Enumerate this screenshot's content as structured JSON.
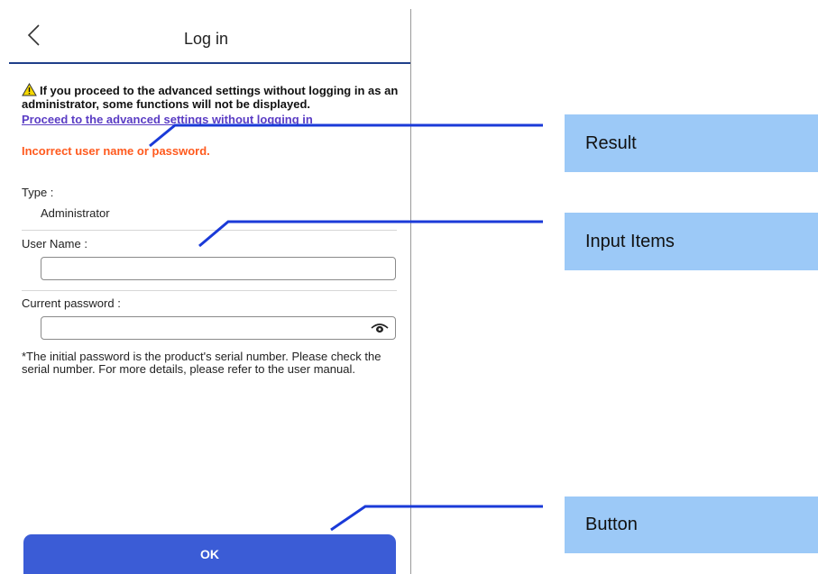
{
  "header": {
    "title": "Log in"
  },
  "warning": {
    "text": "If you proceed to the advanced settings without logging in as an administrator, some functions will not be displayed.",
    "link": "Proceed to the advanced settings without logging in"
  },
  "error": {
    "text": "Incorrect user name or password."
  },
  "form": {
    "type_label": "Type :",
    "type_value": "Administrator",
    "username_label": "User Name :",
    "username_value": "",
    "password_label": "Current password :",
    "password_value": "",
    "note": "*The initial password is the product's serial number. Please check the serial number. For more details, please refer to the user manual."
  },
  "ok_label": "OK",
  "callouts": {
    "result": "Result",
    "input_items": "Input Items",
    "button": "Button"
  },
  "colors": {
    "button": "#3b5cd6",
    "error": "#ff5a1e",
    "link": "#5a3cc4",
    "callout_bg": "#9cc9f7",
    "leader": "#1a3ad8",
    "warning_icon": "#f5d800"
  },
  "icons": {
    "back": "chevron-left-icon",
    "warning": "warning-icon",
    "password_toggle": "eye-icon"
  }
}
